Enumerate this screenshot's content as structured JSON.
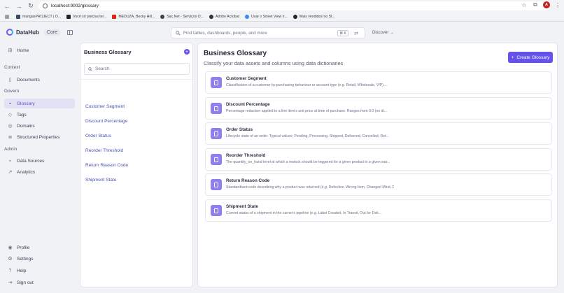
{
  "browser": {
    "url": "localhost:9002/glossary",
    "profile_initial": "A",
    "bookmarks": [
      {
        "label": "mangasPROJECT | O...",
        "icon": "manga-icon"
      },
      {
        "label": "Você só precisa ter...",
        "icon": "notion-icon"
      },
      {
        "label": "MEDUZA, Becky Hill...",
        "icon": "youtube-icon"
      },
      {
        "label": "Sac.Net - Serviços O...",
        "icon": "globe-icon"
      },
      {
        "label": "Adobe Acrobat",
        "icon": "acrobat-icon"
      },
      {
        "label": "Usar o Street View n...",
        "icon": "google-icon"
      },
      {
        "label": "Mais vendidos no St...",
        "icon": "steam-icon"
      }
    ]
  },
  "app": {
    "brand": "DataHub",
    "edition": "Core",
    "search_placeholder": "Find tables, dashboards, people, and more",
    "search_shortcut": "⌘ K",
    "discover_label": "Discover →"
  },
  "sidebar": {
    "home": "Home",
    "context_title": "Context",
    "documents": "Documents",
    "govern_title": "Govern",
    "glossary": "Glossary",
    "tags": "Tags",
    "domains": "Domains",
    "structured_properties": "Structured Properties",
    "admin_title": "Admin",
    "data_sources": "Data Sources",
    "analytics": "Analytics",
    "profile": "Profile",
    "settings": "Settings",
    "help": "Help",
    "sign_out": "Sign out"
  },
  "list_panel": {
    "title": "Business Glossary",
    "add_icon": "+",
    "search_placeholder": "Search",
    "terms": [
      "Customer Segment",
      "Discount Percentage",
      "Order Status",
      "Reorder Threshold",
      "Return Reason Code",
      "Shipment State"
    ]
  },
  "main": {
    "title": "Business Glossary",
    "subtitle": "Classify your data assets and columns using data dictionaries",
    "create_label": "Create Glossary",
    "create_icon": "+",
    "cards": [
      {
        "name": "Customer Segment",
        "desc": "Classification of a customer by purchasing behaviour or account type (e.g. Retail, Wholesale, VIP)...."
      },
      {
        "name": "Discount Percentage",
        "desc": "Percentage reduction applied to a line item's unit price at time of purchase. Ranges from 0.0 (no di..."
      },
      {
        "name": "Order Status",
        "desc": "Lifecycle state of an order. Typical values: Pending, Processing, Shipped, Delivered, Cancelled, Ret..."
      },
      {
        "name": "Reorder Threshold",
        "desc": "The quantity_on_hand level at which a restock should be triggered for a given product in a given war..."
      },
      {
        "name": "Return Reason Code",
        "desc": "Standardised code describing why a product was returned (e.g. Defective, Wrong Item, Changed Mind, D..."
      },
      {
        "name": "Shipment State",
        "desc": "Current status of a shipment in the carrier's pipeline (e.g. Label Created, In Transit, Out for Deli..."
      }
    ]
  },
  "colors": {
    "accent": "#6552e8",
    "active_bg": "#e3e2f4",
    "link": "#4b50b4"
  }
}
